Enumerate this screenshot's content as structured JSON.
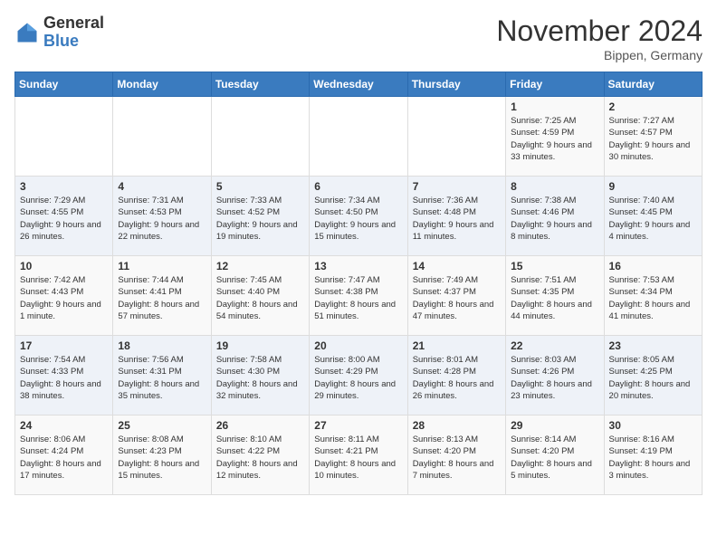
{
  "logo": {
    "text_general": "General",
    "text_blue": "Blue"
  },
  "header": {
    "month": "November 2024",
    "location": "Bippen, Germany"
  },
  "days_of_week": [
    "Sunday",
    "Monday",
    "Tuesday",
    "Wednesday",
    "Thursday",
    "Friday",
    "Saturday"
  ],
  "weeks": [
    [
      {
        "day": "",
        "info": ""
      },
      {
        "day": "",
        "info": ""
      },
      {
        "day": "",
        "info": ""
      },
      {
        "day": "",
        "info": ""
      },
      {
        "day": "",
        "info": ""
      },
      {
        "day": "1",
        "info": "Sunrise: 7:25 AM\nSunset: 4:59 PM\nDaylight: 9 hours and 33 minutes."
      },
      {
        "day": "2",
        "info": "Sunrise: 7:27 AM\nSunset: 4:57 PM\nDaylight: 9 hours and 30 minutes."
      }
    ],
    [
      {
        "day": "3",
        "info": "Sunrise: 7:29 AM\nSunset: 4:55 PM\nDaylight: 9 hours and 26 minutes."
      },
      {
        "day": "4",
        "info": "Sunrise: 7:31 AM\nSunset: 4:53 PM\nDaylight: 9 hours and 22 minutes."
      },
      {
        "day": "5",
        "info": "Sunrise: 7:33 AM\nSunset: 4:52 PM\nDaylight: 9 hours and 19 minutes."
      },
      {
        "day": "6",
        "info": "Sunrise: 7:34 AM\nSunset: 4:50 PM\nDaylight: 9 hours and 15 minutes."
      },
      {
        "day": "7",
        "info": "Sunrise: 7:36 AM\nSunset: 4:48 PM\nDaylight: 9 hours and 11 minutes."
      },
      {
        "day": "8",
        "info": "Sunrise: 7:38 AM\nSunset: 4:46 PM\nDaylight: 9 hours and 8 minutes."
      },
      {
        "day": "9",
        "info": "Sunrise: 7:40 AM\nSunset: 4:45 PM\nDaylight: 9 hours and 4 minutes."
      }
    ],
    [
      {
        "day": "10",
        "info": "Sunrise: 7:42 AM\nSunset: 4:43 PM\nDaylight: 9 hours and 1 minute."
      },
      {
        "day": "11",
        "info": "Sunrise: 7:44 AM\nSunset: 4:41 PM\nDaylight: 8 hours and 57 minutes."
      },
      {
        "day": "12",
        "info": "Sunrise: 7:45 AM\nSunset: 4:40 PM\nDaylight: 8 hours and 54 minutes."
      },
      {
        "day": "13",
        "info": "Sunrise: 7:47 AM\nSunset: 4:38 PM\nDaylight: 8 hours and 51 minutes."
      },
      {
        "day": "14",
        "info": "Sunrise: 7:49 AM\nSunset: 4:37 PM\nDaylight: 8 hours and 47 minutes."
      },
      {
        "day": "15",
        "info": "Sunrise: 7:51 AM\nSunset: 4:35 PM\nDaylight: 8 hours and 44 minutes."
      },
      {
        "day": "16",
        "info": "Sunrise: 7:53 AM\nSunset: 4:34 PM\nDaylight: 8 hours and 41 minutes."
      }
    ],
    [
      {
        "day": "17",
        "info": "Sunrise: 7:54 AM\nSunset: 4:33 PM\nDaylight: 8 hours and 38 minutes."
      },
      {
        "day": "18",
        "info": "Sunrise: 7:56 AM\nSunset: 4:31 PM\nDaylight: 8 hours and 35 minutes."
      },
      {
        "day": "19",
        "info": "Sunrise: 7:58 AM\nSunset: 4:30 PM\nDaylight: 8 hours and 32 minutes."
      },
      {
        "day": "20",
        "info": "Sunrise: 8:00 AM\nSunset: 4:29 PM\nDaylight: 8 hours and 29 minutes."
      },
      {
        "day": "21",
        "info": "Sunrise: 8:01 AM\nSunset: 4:28 PM\nDaylight: 8 hours and 26 minutes."
      },
      {
        "day": "22",
        "info": "Sunrise: 8:03 AM\nSunset: 4:26 PM\nDaylight: 8 hours and 23 minutes."
      },
      {
        "day": "23",
        "info": "Sunrise: 8:05 AM\nSunset: 4:25 PM\nDaylight: 8 hours and 20 minutes."
      }
    ],
    [
      {
        "day": "24",
        "info": "Sunrise: 8:06 AM\nSunset: 4:24 PM\nDaylight: 8 hours and 17 minutes."
      },
      {
        "day": "25",
        "info": "Sunrise: 8:08 AM\nSunset: 4:23 PM\nDaylight: 8 hours and 15 minutes."
      },
      {
        "day": "26",
        "info": "Sunrise: 8:10 AM\nSunset: 4:22 PM\nDaylight: 8 hours and 12 minutes."
      },
      {
        "day": "27",
        "info": "Sunrise: 8:11 AM\nSunset: 4:21 PM\nDaylight: 8 hours and 10 minutes."
      },
      {
        "day": "28",
        "info": "Sunrise: 8:13 AM\nSunset: 4:20 PM\nDaylight: 8 hours and 7 minutes."
      },
      {
        "day": "29",
        "info": "Sunrise: 8:14 AM\nSunset: 4:20 PM\nDaylight: 8 hours and 5 minutes."
      },
      {
        "day": "30",
        "info": "Sunrise: 8:16 AM\nSunset: 4:19 PM\nDaylight: 8 hours and 3 minutes."
      }
    ]
  ]
}
